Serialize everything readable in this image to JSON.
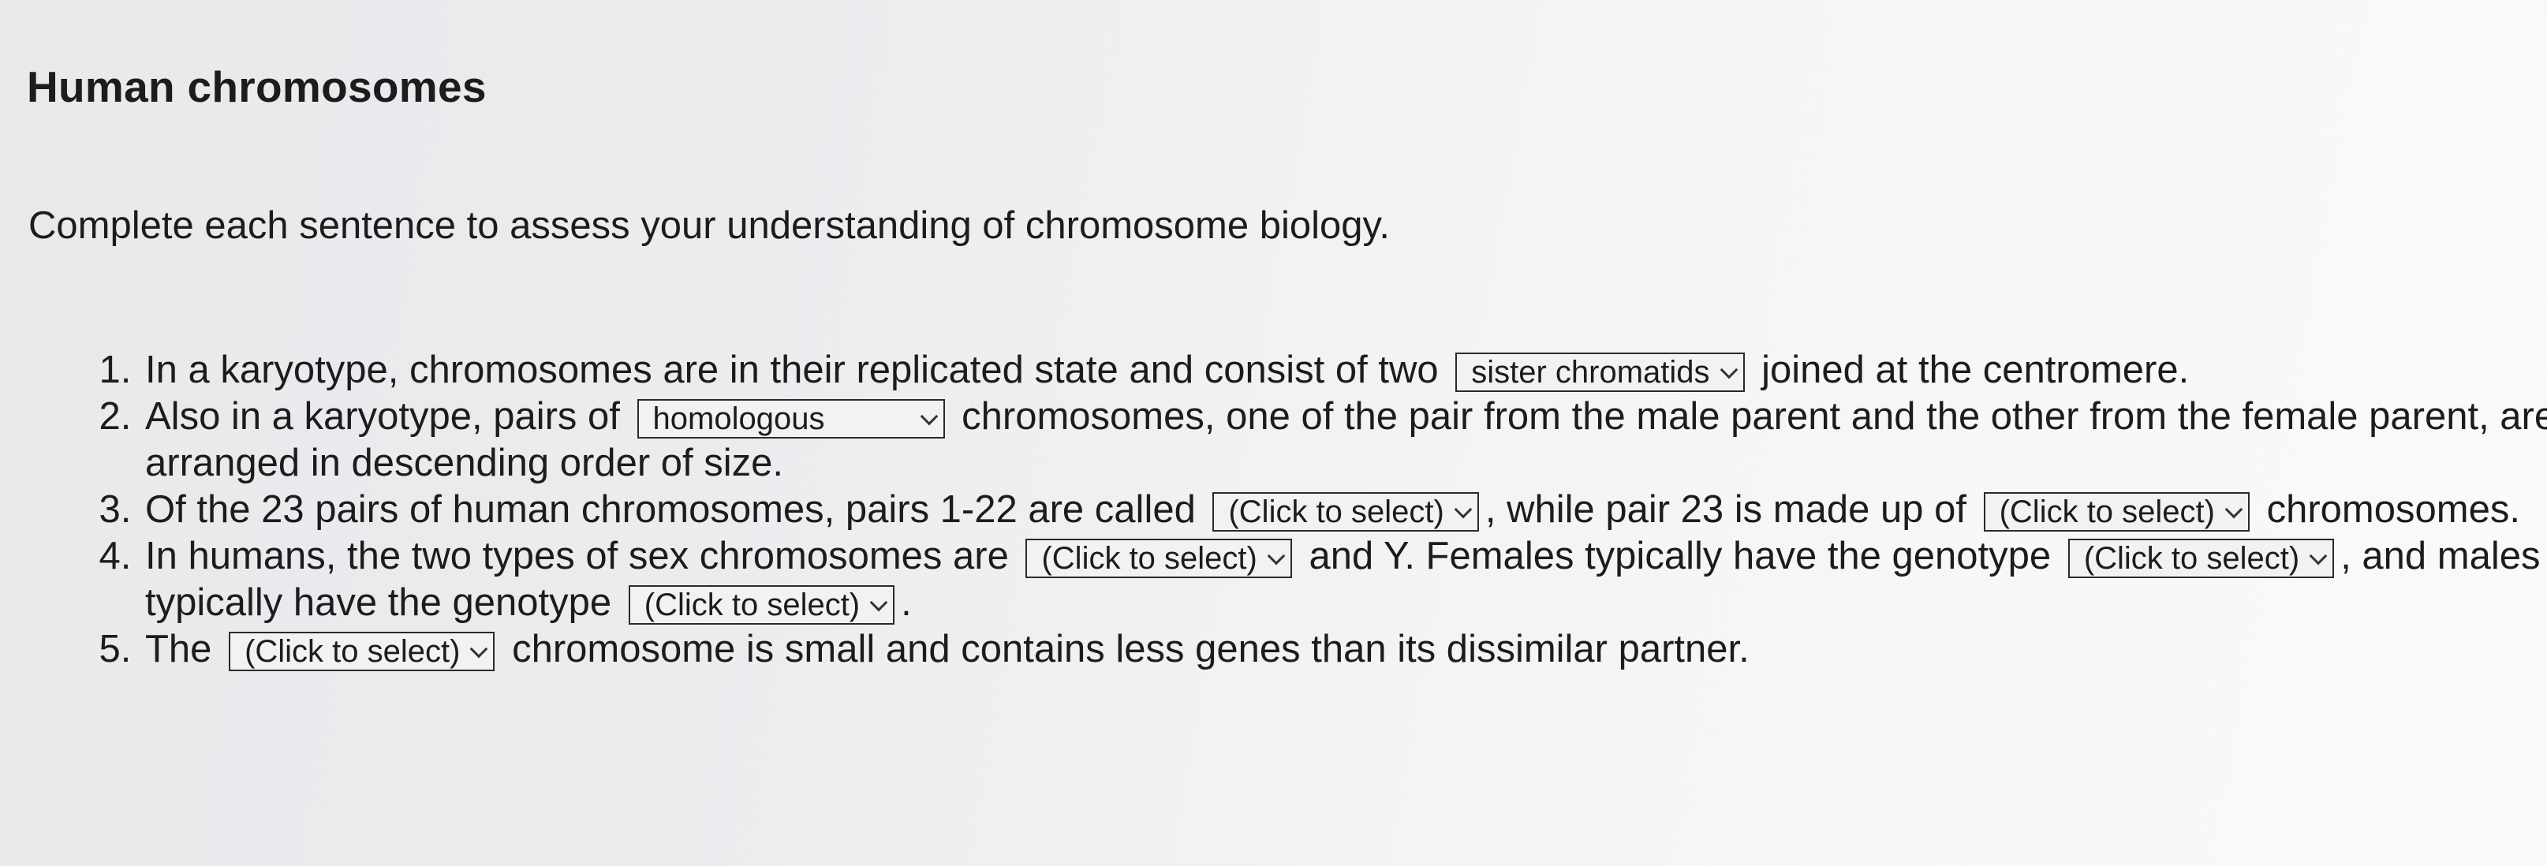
{
  "header": {
    "title": "Human chromosomes"
  },
  "intro": "Complete each sentence to assess your understanding of chromosome biology.",
  "questions": [
    {
      "part1": "In a karyotype, chromosomes are in their replicated state and consist of two",
      "select1": "sister chromatids",
      "part2": "joined at the centromere."
    },
    {
      "part1": "Also in a karyotype, pairs of",
      "select1": "homologous",
      "part2": "chromosomes, one of the pair from the male parent and the other from the female parent, are arranged in descending order of size."
    },
    {
      "part1": "Of the 23 pairs of human chromosomes, pairs 1-22 are called",
      "select1": "(Click to select)",
      "part2": ", while pair 23 is made up of",
      "select2": "(Click to select)",
      "part3": "chromosomes."
    },
    {
      "part1": "In humans, the two types of sex chromosomes are",
      "select1": "(Click to select)",
      "part2": "and Y. Females typically have the genotype",
      "select2": "(Click to select)",
      "part3": ", and males typically have the genotype",
      "select3": "(Click to select)",
      "part4": "."
    },
    {
      "part1": "The",
      "select1": "(Click to select)",
      "part2": "chromosome is small and contains less genes than its dissimilar partner."
    }
  ]
}
